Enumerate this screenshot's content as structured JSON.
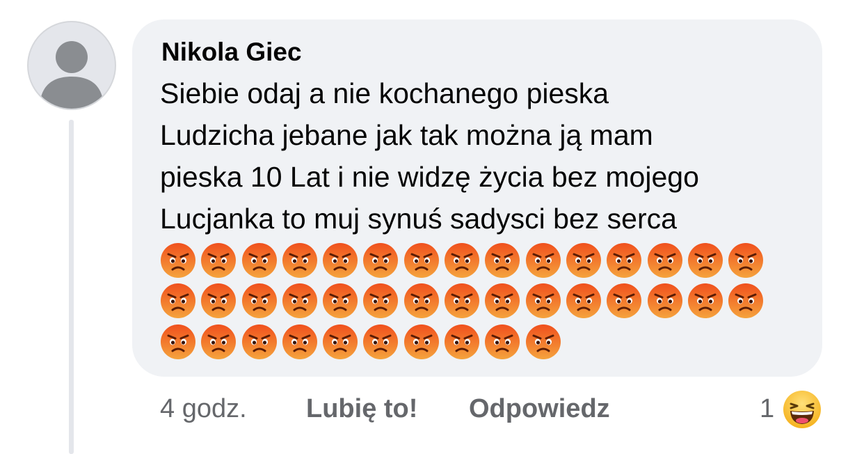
{
  "comment": {
    "author": "Nikola Giec",
    "lines": [
      "Siebie odaj a nie kochanego pieska",
      "Ludzicha jebane jak tak można ją mam",
      "pieska 10 Lat i nie widzę życia bez mojego",
      "Lucjanka to muj synuś sadysci bez serca"
    ],
    "emoji_rows": [
      15,
      15,
      10
    ],
    "emoji_name": "pouting-face-emoji"
  },
  "actions": {
    "time": "4 godz.",
    "like": "Lubię to!",
    "reply": "Odpowiedz"
  },
  "reactions": {
    "count": "1",
    "icon": "laughing-face-emoji"
  },
  "colors": {
    "bubble": "#f0f2f5",
    "text": "#050505",
    "secondary_text": "#65676b",
    "avatar_bg": "#e4e6eb",
    "avatar_silhouette": "#8a8d91",
    "emoji_angry_top": "#f0501d",
    "emoji_angry_bottom": "#f5a33d",
    "emoji_haha": "#f7c630"
  }
}
